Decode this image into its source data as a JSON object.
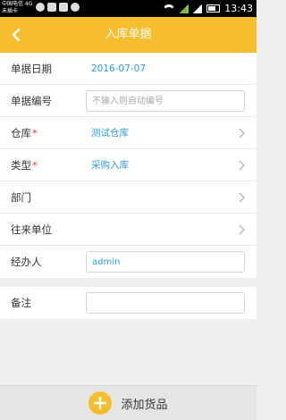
{
  "status_bar": {
    "carrier_line1": "中国电信 4G",
    "carrier_line2": "未插卡",
    "time": "13:43"
  },
  "header": {
    "title": "入库单据",
    "back_icon": "chevron-left-icon"
  },
  "form": {
    "date": {
      "label": "单据日期",
      "value": "2016-07-07"
    },
    "number": {
      "label": "单据编号",
      "placeholder": "不输入则自动编号"
    },
    "warehouse": {
      "label": "仓库",
      "required_mark": "*",
      "value": "测试仓库"
    },
    "type": {
      "label": "类型",
      "required_mark": "*",
      "value": "采购入库"
    },
    "department": {
      "label": "部门"
    },
    "partner": {
      "label": "往来单位"
    },
    "handler": {
      "label": "经办人",
      "value": "admin"
    },
    "remark": {
      "label": "备注",
      "value": ""
    }
  },
  "bottom": {
    "add_label": "添加货品",
    "icon": "plus-circle-icon"
  },
  "colors": {
    "accent": "#f6be2e",
    "link": "#2c9ae0",
    "required": "#e53935"
  }
}
